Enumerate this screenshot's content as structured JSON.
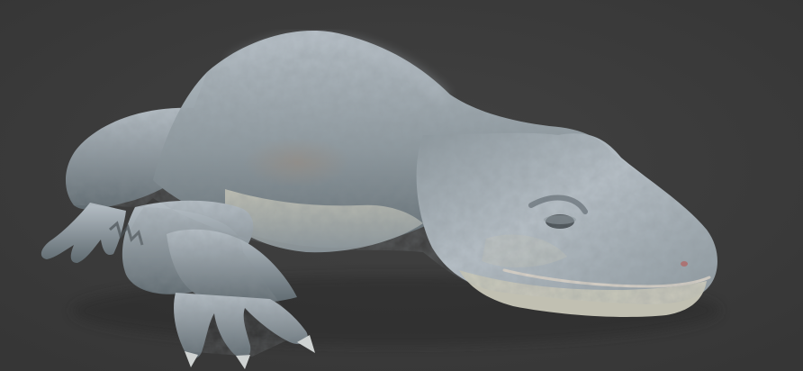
{
  "scene": {
    "subject": "",
    "background_color": "#3c3c3c",
    "palette": {
      "skin_light": "#b7c0c7",
      "skin_mid": "#8e999f",
      "skin_dark": "#5f6a70",
      "skin_shadow": "#4b5257",
      "belly": "#c9c8b9",
      "warm_tint": "#9a8a7c",
      "mouth_line": "#d9d2c8",
      "nostril": "#b07070",
      "claw": "#cfd3d2"
    }
  }
}
